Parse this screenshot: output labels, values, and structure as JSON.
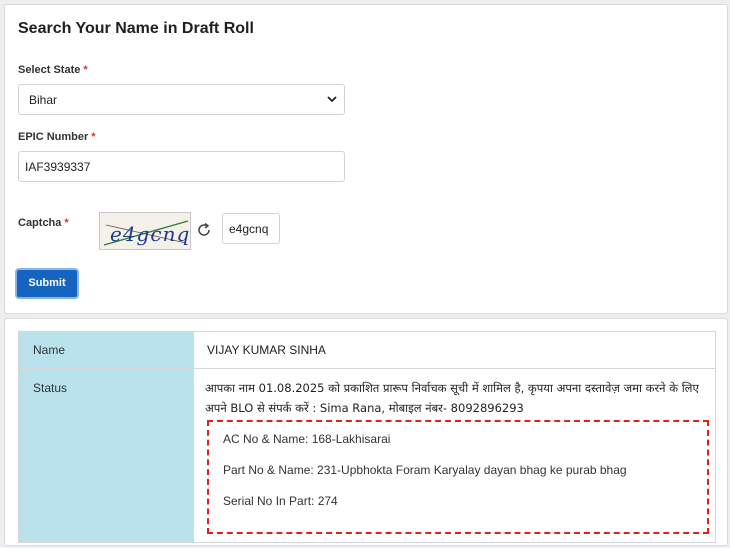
{
  "form": {
    "title": "Search Your Name in Draft Roll",
    "state_label": "Select State",
    "state_value": "Bihar",
    "epic_label": "EPIC Number",
    "epic_value": "IAF3939337",
    "captcha_label": "Captcha",
    "captcha_image_text": "e4gcnq",
    "captcha_value": "e4gcnq",
    "required_mark": "*",
    "submit_label": "Submit"
  },
  "result": {
    "name_header": "Name",
    "name_value": "VIJAY KUMAR SINHA",
    "status_header": "Status",
    "status_message": "आपका नाम 01.08.2025 को प्रकाशित प्रारूप निर्वाचक सूची में शामिल है, कृपया अपना दस्तावेज़ जमा करने के लिए अपने BLO से संपर्क करें : Sima Rana, मोबाइल नंबर- 8092896293",
    "ac_line": "AC No & Name: 168-Lakhisarai",
    "part_line": "Part No & Name: 231-Upbhokta Foram Karyalay dayan bhag ke purab bhag",
    "serial_line": "Serial No In Part: 274"
  },
  "colors": {
    "accent": "#1565c0",
    "table_header_bg": "#b9e2ec",
    "highlight_border": "#e0201f"
  },
  "icons": {
    "select_arrow": "chevron-down-icon",
    "refresh": "refresh-icon"
  }
}
